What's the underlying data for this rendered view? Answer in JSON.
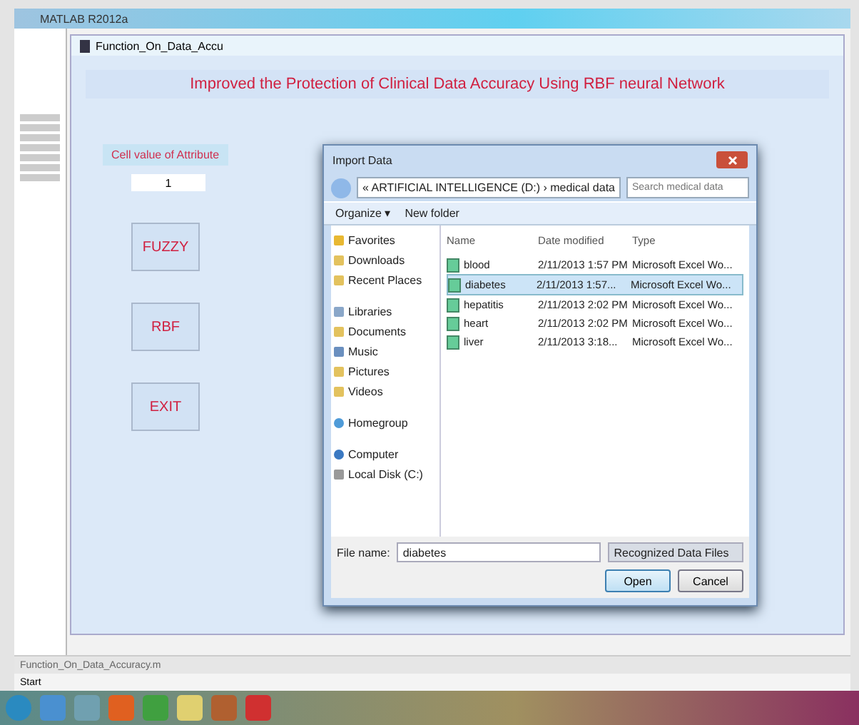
{
  "window": {
    "title": "MATLAB R2012a"
  },
  "figure": {
    "title": "Function_On_Data_Accu",
    "heading": "Improved the Protection of Clinical Data Accuracy Using RBF neural Network",
    "field_label": "Cell value of Attribute",
    "field_value": "1",
    "buttons": [
      "FUZZY",
      "RBF",
      "EXIT"
    ]
  },
  "dialog": {
    "title": "Import Data",
    "path": "« ARTIFICIAL INTELLIGENCE (D:) › medical data",
    "search": {
      "placeholder": "Search medical data"
    },
    "toolbar": [
      "Organize ▾",
      "New folder"
    ],
    "nav": [
      {
        "label": "Favorites",
        "kind": "star"
      },
      {
        "label": "Downloads",
        "kind": "folder"
      },
      {
        "label": "Recent Places",
        "kind": "folder"
      },
      {
        "label": "Libraries",
        "kind": "library"
      },
      {
        "label": "Documents",
        "kind": "folder"
      },
      {
        "label": "Music",
        "kind": "music"
      },
      {
        "label": "Pictures",
        "kind": "folder"
      },
      {
        "label": "Videos",
        "kind": "folder"
      },
      {
        "label": "Homegroup",
        "kind": "group"
      },
      {
        "label": "Computer",
        "kind": "computer"
      },
      {
        "label": "Local Disk (C:)",
        "kind": "disk"
      }
    ],
    "columns": [
      "Name",
      "Date modified",
      "Type"
    ],
    "files": [
      {
        "name": "blood",
        "date": "2/11/2013 1:57 PM",
        "type": "Microsoft Excel Wo...",
        "selected": false
      },
      {
        "name": "diabetes",
        "date": "2/11/2013 1:57...",
        "type": "Microsoft Excel Wo...",
        "selected": true
      },
      {
        "name": "hepatitis",
        "date": "2/11/2013 2:02 PM",
        "type": "Microsoft Excel Wo...",
        "selected": false
      },
      {
        "name": "heart",
        "date": "2/11/2013 2:02 PM",
        "type": "Microsoft Excel Wo...",
        "selected": false
      },
      {
        "name": "liver",
        "date": "2/11/2013 3:18...",
        "type": "Microsoft Excel Wo...",
        "selected": false
      }
    ],
    "file_name_label": "File name:",
    "file_name": "diabetes",
    "file_type": "Recognized Data Files",
    "buttons": [
      "Open",
      "Cancel"
    ]
  },
  "status_bar": {
    "text": "Function_On_Data_Accuracy.m",
    "mode": "Start"
  }
}
